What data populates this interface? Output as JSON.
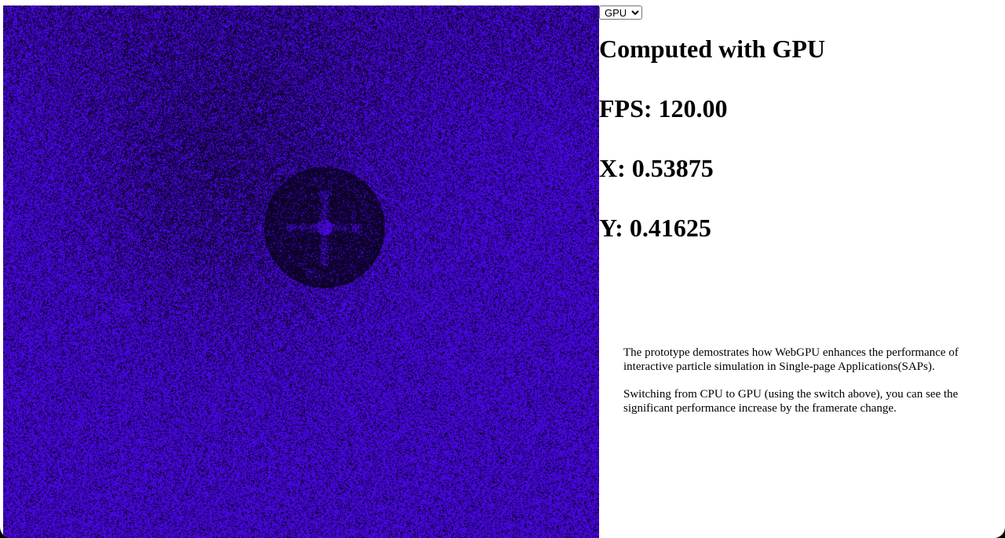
{
  "colors": {
    "particle": "#5a0aff",
    "particle_dark": "#2a0480",
    "background": "#000000",
    "panel": "#ffffff"
  },
  "controls": {
    "mode_options": [
      "GPU"
    ],
    "mode_selected": "GPU"
  },
  "stats": {
    "title": "Computed with GPU",
    "fps": "FPS: 120.00",
    "x": "X: 0.53875",
    "y": "Y: 0.41625"
  },
  "simulation": {
    "attractor_x": 0.53875,
    "attractor_y": 0.41625
  },
  "description": {
    "paragraph_1": "The prototype demostrates how WebGPU enhances the performance of interactive particle simulation in Single-page Applications(SAPs).",
    "paragraph_2": "Switching from CPU to GPU (using the switch above), you can see the significant performance increase by the framerate change."
  }
}
